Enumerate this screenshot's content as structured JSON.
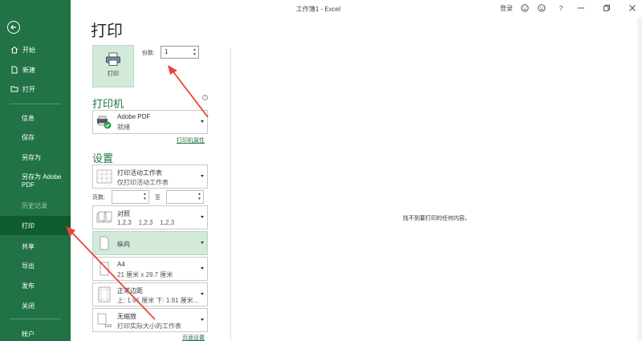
{
  "window": {
    "title": "工作簿1 - Excel",
    "signin": "登录",
    "help": "?"
  },
  "sidebar": {
    "items": [
      {
        "label": "开始"
      },
      {
        "label": "新建"
      },
      {
        "label": "打开"
      },
      {
        "label": "信息"
      },
      {
        "label": "保存"
      },
      {
        "label": "另存为"
      },
      {
        "label": "另存为 Adobe PDF"
      },
      {
        "label": "历史记录"
      },
      {
        "label": "打印"
      },
      {
        "label": "共享"
      },
      {
        "label": "导出"
      },
      {
        "label": "发布"
      },
      {
        "label": "关闭"
      },
      {
        "label": "帐户"
      }
    ]
  },
  "page": {
    "title": "打印"
  },
  "print": {
    "button_label": "打印",
    "copies_label": "份数:",
    "copies_value": "1"
  },
  "printer": {
    "section_title": "打印机",
    "name": "Adobe PDF",
    "status": "就绪",
    "properties_link": "打印机属性"
  },
  "settings": {
    "section_title": "设置",
    "what": {
      "line1": "打印活动工作表",
      "line2": "仅打印活动工作表"
    },
    "pages_label": "页数:",
    "pages_to": "至",
    "collate": {
      "line1": "对照",
      "line2": "1,2,3    1,2,3    1,2,3"
    },
    "orientation": {
      "line1": "纵向"
    },
    "paper": {
      "line1": "A4",
      "line2": "21 厘米 x 29.7 厘米"
    },
    "margins": {
      "line1": "正常边距",
      "line2": "上: 1.91 厘米 下: 1.91 厘米..."
    },
    "scaling": {
      "line1": "无缩放",
      "line2": "打印实际大小的工作表"
    },
    "page_setup_link": "页面设置"
  },
  "preview": {
    "message": "找不到要打印的任何内容。"
  },
  "colors": {
    "accent": "#217346",
    "active": "#0e5c2f",
    "highlight": "#d3eadb",
    "annotation": "#e8463b"
  }
}
